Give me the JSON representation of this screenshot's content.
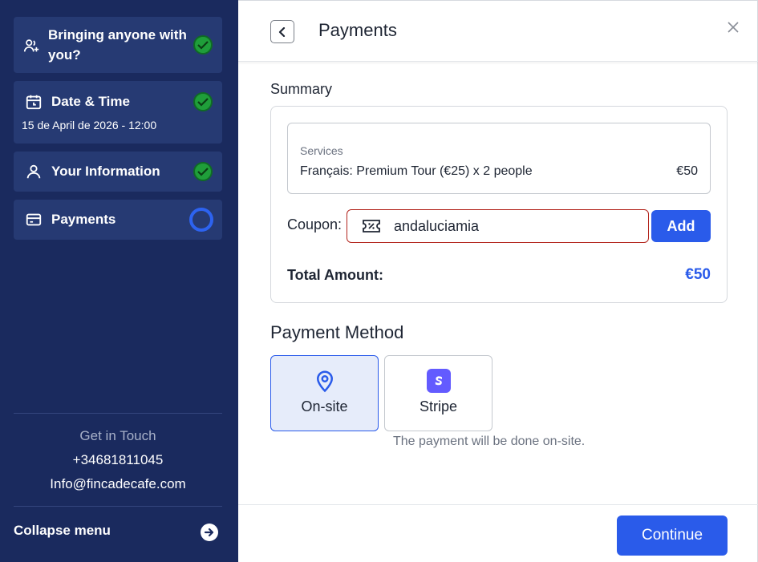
{
  "sidebar": {
    "steps": [
      {
        "title_line1": "Bringing anyone with",
        "title_line2": "you?",
        "icon": "users-add-icon",
        "status": "complete"
      },
      {
        "title": "Date & Time",
        "subtitle": "15 de April de 2026  - 12:00",
        "icon": "calendar-icon",
        "status": "complete"
      },
      {
        "title": "Your Information",
        "icon": "user-icon",
        "status": "complete"
      },
      {
        "title": "Payments",
        "icon": "card-icon",
        "status": "current"
      }
    ],
    "contact": {
      "heading": "Get in Touch",
      "phone": "+34681811045",
      "email": "Info@fincadecafe.com"
    },
    "collapse_label": "Collapse menu"
  },
  "header": {
    "title": "Payments"
  },
  "summary": {
    "label": "Summary",
    "services_heading": "Services",
    "service_line": "Français: Premium Tour (€25) x 2 people",
    "service_price": "€50",
    "coupon_label": "Coupon:",
    "coupon_value": "andaluciamia",
    "add_label": "Add",
    "total_label": "Total Amount:",
    "total_value": "€50"
  },
  "payment_method": {
    "label": "Payment Method",
    "options": [
      {
        "label": "On-site",
        "icon": "location-pin-icon",
        "selected": true
      },
      {
        "label": "Stripe",
        "icon": "stripe-logo-icon",
        "selected": false
      }
    ],
    "note": "The payment will be done on-site."
  },
  "footer": {
    "continue_label": "Continue"
  },
  "colors": {
    "sidebar_bg": "#1a2a5e",
    "step_bg": "#263a73",
    "accent": "#2a5bea",
    "check_green": "#1f9e3a",
    "error_border": "#b3261e"
  }
}
